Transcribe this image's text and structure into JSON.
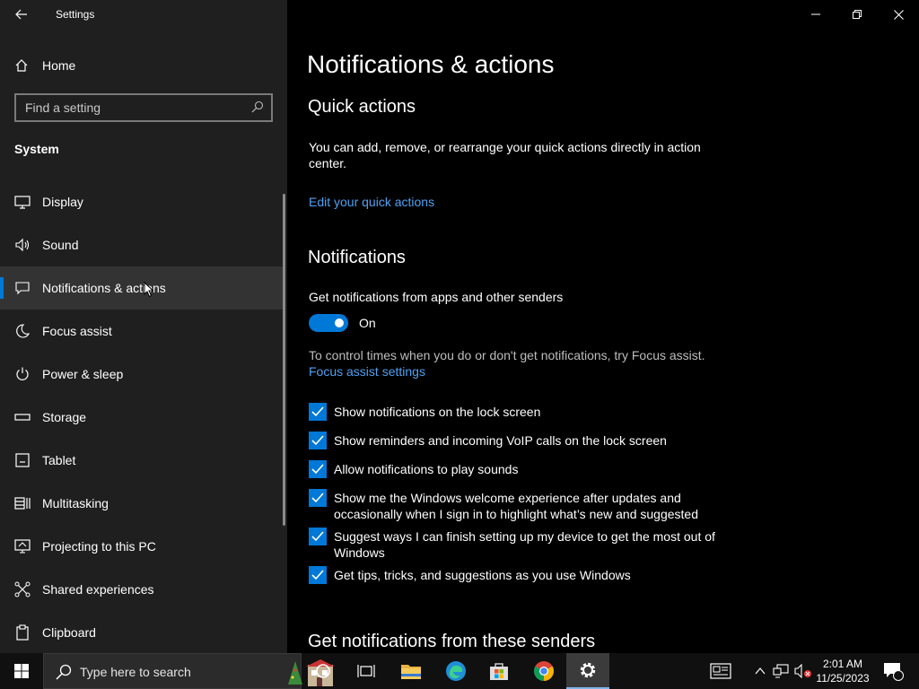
{
  "window": {
    "title": "Settings"
  },
  "sidebar": {
    "home_label": "Home",
    "search_placeholder": "Find a setting",
    "section": "System",
    "items": [
      {
        "label": "Display",
        "icon": "monitor-icon"
      },
      {
        "label": "Sound",
        "icon": "speaker-icon"
      },
      {
        "label": "Notifications & actions",
        "icon": "message-icon",
        "selected": true
      },
      {
        "label": "Focus assist",
        "icon": "moon-icon"
      },
      {
        "label": "Power & sleep",
        "icon": "power-icon"
      },
      {
        "label": "Storage",
        "icon": "storage-icon"
      },
      {
        "label": "Tablet",
        "icon": "tablet-icon"
      },
      {
        "label": "Multitasking",
        "icon": "multitasking-icon"
      },
      {
        "label": "Projecting to this PC",
        "icon": "projecting-icon"
      },
      {
        "label": "Shared experiences",
        "icon": "shared-icon"
      },
      {
        "label": "Clipboard",
        "icon": "clipboard-icon"
      }
    ]
  },
  "main": {
    "title": "Notifications & actions",
    "quick_actions": {
      "heading": "Quick actions",
      "description": "You can add, remove, or rearrange your quick actions directly in action center.",
      "link": "Edit your quick actions"
    },
    "notifications": {
      "heading": "Notifications",
      "toggle_label": "Get notifications from apps and other senders",
      "toggle_state": "On",
      "focus_text": "To control times when you do or don't get notifications, try Focus assist.",
      "focus_link": "Focus assist settings",
      "checkboxes": [
        "Show notifications on the lock screen",
        "Show reminders and incoming VoIP calls on the lock screen",
        "Allow notifications to play sounds",
        "Show me the Windows welcome experience after updates and occasionally when I sign in to highlight what’s new and suggested",
        "Suggest ways I can finish setting up my device to get the most out of Windows",
        "Get tips, tricks, and suggestions as you use Windows"
      ]
    },
    "senders_heading": "Get notifications from these senders"
  },
  "taskbar": {
    "search_placeholder": "Type here to search",
    "time": "2:01 AM",
    "date": "11/25/2023",
    "notification_count": "1"
  },
  "colors": {
    "accent": "#0078d7",
    "link": "#4ea1f3",
    "sidebar_bg": "#1f1f1f",
    "selected_bg": "#333333"
  }
}
